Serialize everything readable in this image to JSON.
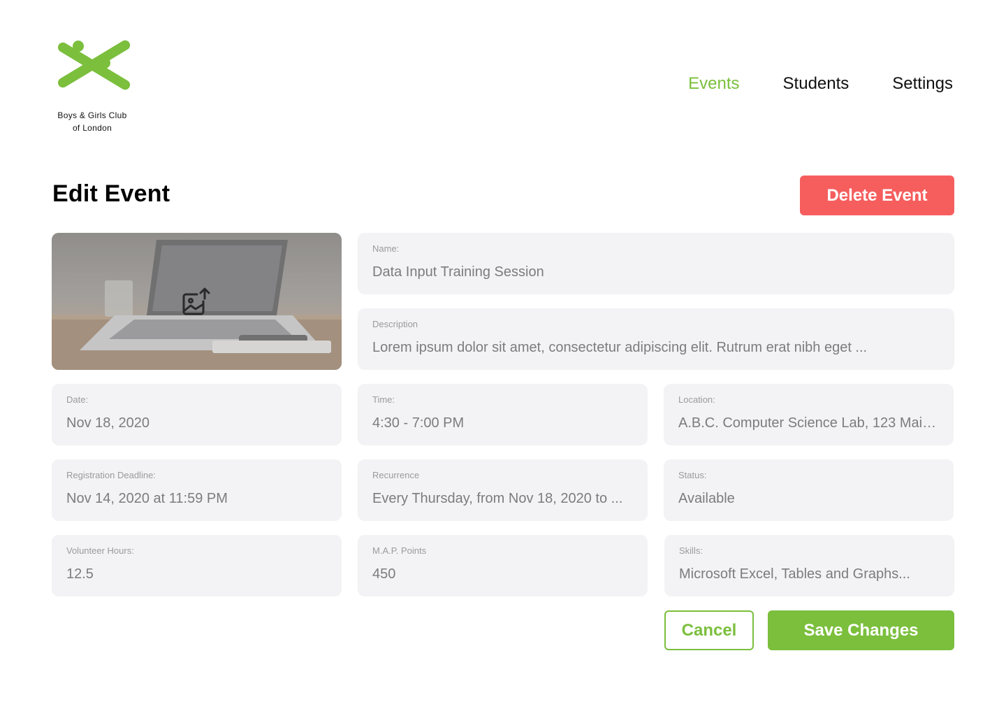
{
  "brand": {
    "name_line1": "Boys & Girls Club",
    "name_line2": "of London",
    "colors": {
      "accent": "#7bbf3d",
      "danger": "#f65e5e",
      "field_bg": "#f3f3f5"
    }
  },
  "nav": {
    "items": [
      {
        "label": "Events",
        "active": true
      },
      {
        "label": "Students",
        "active": false
      },
      {
        "label": "Settings",
        "active": false
      }
    ]
  },
  "page": {
    "title": "Edit Event",
    "delete_label": "Delete Event",
    "cancel_label": "Cancel",
    "save_label": "Save Changes"
  },
  "image": {
    "icon": "image-upload-icon"
  },
  "fields": {
    "name": {
      "label": "Name:",
      "value": "Data Input Training Session"
    },
    "description": {
      "label": "Description",
      "value": "Lorem ipsum dolor sit amet, consectetur adipiscing elit. Rutrum erat nibh eget ..."
    },
    "date": {
      "label": "Date:",
      "value": "Nov 18, 2020"
    },
    "time": {
      "label": "Time:",
      "value": "4:30 - 7:00 PM"
    },
    "location": {
      "label": "Location:",
      "value": "A.B.C. Computer Science Lab, 123 Main..."
    },
    "registration_deadline": {
      "label": "Registration Deadline:",
      "value": "Nov 14, 2020 at 11:59 PM"
    },
    "recurrence": {
      "label": "Recurrence",
      "value": "Every Thursday, from Nov 18, 2020 to ..."
    },
    "status": {
      "label": "Status:",
      "value": "Available"
    },
    "volunteer_hours": {
      "label": "Volunteer Hours:",
      "value": "12.5"
    },
    "map_points": {
      "label": "M.A.P. Points",
      "value": "450"
    },
    "skills": {
      "label": "Skills:",
      "value": "Microsoft Excel, Tables and Graphs..."
    }
  }
}
